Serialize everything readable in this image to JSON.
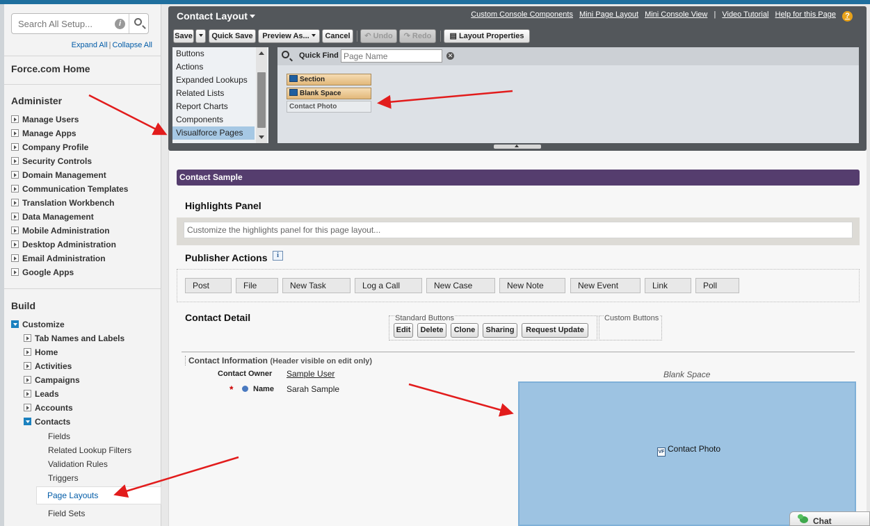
{
  "sidebar": {
    "search_placeholder": "Search All Setup...",
    "expand_all": "Expand All",
    "collapse_all": "Collapse All",
    "link_separator": "|",
    "force_home": "Force.com Home",
    "administer_title": "Administer",
    "administer_items": [
      "Manage Users",
      "Manage Apps",
      "Company Profile",
      "Security Controls",
      "Domain Management",
      "Communication Templates",
      "Translation Workbench",
      "Data Management",
      "Mobile Administration",
      "Desktop Administration",
      "Email Administration",
      "Google Apps"
    ],
    "build_title": "Build",
    "customize": "Customize",
    "customize_items": [
      "Tab Names and Labels",
      "Home",
      "Activities",
      "Campaigns",
      "Leads",
      "Accounts"
    ],
    "contacts": "Contacts",
    "contacts_items": [
      "Fields",
      "Related Lookup Filters",
      "Validation Rules",
      "Triggers",
      "Page Layouts",
      "Field Sets"
    ]
  },
  "palette": {
    "title": "Contact Layout",
    "links": [
      "Custom Console Components",
      "Mini Page Layout",
      "Mini Console View",
      "Video Tutorial",
      "Help for this Page"
    ],
    "link_separator": "|",
    "help_glyph": "?",
    "toolbar": {
      "save": "Save",
      "quick_save": "Quick Save",
      "preview_as": "Preview As...",
      "cancel": "Cancel",
      "undo": "Undo",
      "redo": "Redo",
      "layout_properties": "Layout Properties"
    },
    "categories": [
      "Buttons",
      "Actions",
      "Expanded Lookups",
      "Related Lists",
      "Report Charts",
      "Components",
      "Visualforce Pages"
    ],
    "selected_category": "Visualforce Pages",
    "quick_find_label": "Quick Find",
    "quick_find_placeholder": "Page Name",
    "items": [
      "Section",
      "Blank Space",
      "Contact Photo"
    ]
  },
  "layout": {
    "sample_title": "Contact Sample",
    "highlights_title": "Highlights Panel",
    "highlights_text": "Customize the highlights panel for this page layout...",
    "publisher_title": "Publisher Actions",
    "info_glyph": "i",
    "publisher_actions": [
      "Post",
      "File",
      "New Task",
      "Log a Call",
      "New Case",
      "New Note",
      "New Event",
      "Link",
      "Poll"
    ],
    "detail_title": "Contact Detail",
    "standard_buttons_label": "Standard Buttons",
    "standard_buttons": [
      "Edit",
      "Delete",
      "Clone",
      "Sharing",
      "Request Update"
    ],
    "custom_buttons_label": "Custom Buttons",
    "section_header": "Contact Information",
    "section_note": "(Header visible on edit only)",
    "owner_label": "Contact Owner",
    "owner_value": "Sample User",
    "required_mark": "*",
    "name_label": "Name",
    "name_value": "Sarah Sample",
    "blank_space_caption": "Blank Space",
    "vf_glyph": "VF",
    "contact_photo": "Contact Photo"
  },
  "chat": {
    "label": "Chat"
  }
}
